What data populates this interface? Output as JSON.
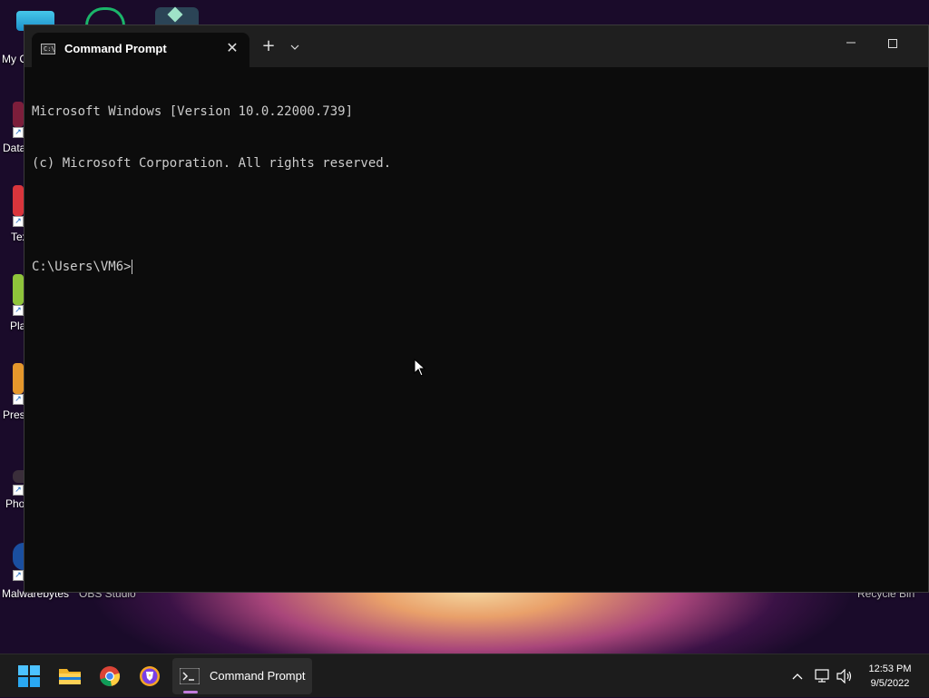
{
  "desktop": {
    "icons": [
      {
        "label": "My C"
      },
      {
        "label": "Data"
      },
      {
        "label": "Tex"
      },
      {
        "label": "Pla"
      },
      {
        "label": "Pres"
      },
      {
        "label": "Pho"
      },
      {
        "label": "Malwarebytes"
      },
      {
        "label": "OBS Studio"
      },
      {
        "label": "Recycle Bin"
      }
    ]
  },
  "window": {
    "tab_title": "Command Prompt",
    "tab_icon_text": "C:\\",
    "new_tab": "+",
    "dropdown": "⌄",
    "close": "✕",
    "minimize": "—"
  },
  "console": {
    "lines": [
      "Microsoft Windows [Version 10.0.22000.739]",
      "(c) Microsoft Corporation. All rights reserved.",
      "",
      "C:\\Users\\VM6>"
    ]
  },
  "taskbar": {
    "active_app_label": "Command Prompt",
    "time": "12:53 PM",
    "date": "9/5/2022"
  },
  "colors": {
    "console_bg": "#0c0c0c",
    "console_fg": "#cccccc",
    "titlebar_bg": "#1f1f1f",
    "taskbar_bg": "#1c1c1c",
    "accent": "#c27bdc"
  }
}
